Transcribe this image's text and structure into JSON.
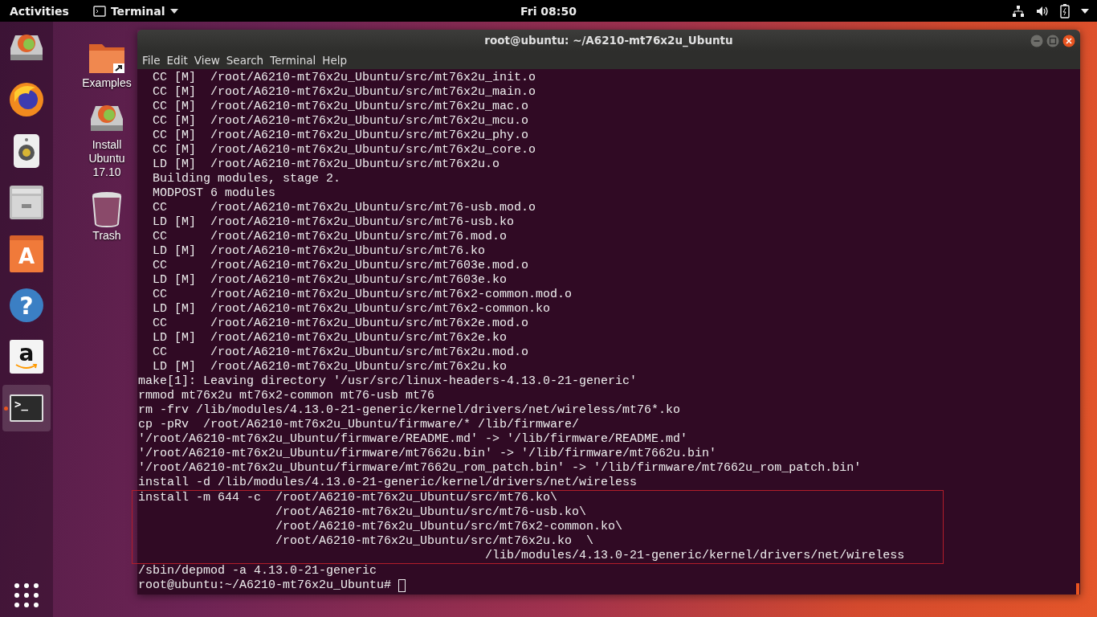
{
  "top_bar": {
    "activities": "Activities",
    "app_menu": "Terminal",
    "clock": "Fri 08:50"
  },
  "dock": [
    {
      "kind": "installer",
      "running": false
    },
    {
      "kind": "browser",
      "running": false
    },
    {
      "kind": "speaker",
      "running": false
    },
    {
      "kind": "files",
      "running": false
    },
    {
      "kind": "software",
      "running": false,
      "glyph": "A"
    },
    {
      "kind": "help",
      "running": false,
      "glyph": "?"
    },
    {
      "kind": "amazon",
      "running": false,
      "glyph": "a"
    },
    {
      "kind": "terminal",
      "running": true,
      "glyph": ">_"
    }
  ],
  "desktop_icons": [
    {
      "kind": "folder",
      "label": "Examples"
    },
    {
      "kind": "installer",
      "label": "Install\nUbuntu\n17.10"
    },
    {
      "kind": "trash",
      "label": "Trash"
    }
  ],
  "window": {
    "title": "root@ubuntu: ~/A6210-mt76x2u_Ubuntu",
    "menu": [
      "File",
      "Edit",
      "View",
      "Search",
      "Terminal",
      "Help"
    ]
  },
  "terminal": {
    "lines_before": [
      "  CC [M]  /root/A6210-mt76x2u_Ubuntu/src/mt76x2u_init.o",
      "  CC [M]  /root/A6210-mt76x2u_Ubuntu/src/mt76x2u_main.o",
      "  CC [M]  /root/A6210-mt76x2u_Ubuntu/src/mt76x2u_mac.o",
      "  CC [M]  /root/A6210-mt76x2u_Ubuntu/src/mt76x2u_mcu.o",
      "  CC [M]  /root/A6210-mt76x2u_Ubuntu/src/mt76x2u_phy.o",
      "  CC [M]  /root/A6210-mt76x2u_Ubuntu/src/mt76x2u_core.o",
      "  LD [M]  /root/A6210-mt76x2u_Ubuntu/src/mt76x2u.o",
      "  Building modules, stage 2.",
      "  MODPOST 6 modules",
      "  CC      /root/A6210-mt76x2u_Ubuntu/src/mt76-usb.mod.o",
      "  LD [M]  /root/A6210-mt76x2u_Ubuntu/src/mt76-usb.ko",
      "  CC      /root/A6210-mt76x2u_Ubuntu/src/mt76.mod.o",
      "  LD [M]  /root/A6210-mt76x2u_Ubuntu/src/mt76.ko",
      "  CC      /root/A6210-mt76x2u_Ubuntu/src/mt7603e.mod.o",
      "  LD [M]  /root/A6210-mt76x2u_Ubuntu/src/mt7603e.ko",
      "  CC      /root/A6210-mt76x2u_Ubuntu/src/mt76x2-common.mod.o",
      "  LD [M]  /root/A6210-mt76x2u_Ubuntu/src/mt76x2-common.ko",
      "  CC      /root/A6210-mt76x2u_Ubuntu/src/mt76x2e.mod.o",
      "  LD [M]  /root/A6210-mt76x2u_Ubuntu/src/mt76x2e.ko",
      "  CC      /root/A6210-mt76x2u_Ubuntu/src/mt76x2u.mod.o",
      "  LD [M]  /root/A6210-mt76x2u_Ubuntu/src/mt76x2u.ko",
      "make[1]: Leaving directory '/usr/src/linux-headers-4.13.0-21-generic'",
      "rmmod mt76x2u mt76x2-common mt76-usb mt76",
      "rm -frv /lib/modules/4.13.0-21-generic/kernel/drivers/net/wireless/mt76*.ko",
      "cp -pRv  /root/A6210-mt76x2u_Ubuntu/firmware/* /lib/firmware/",
      "'/root/A6210-mt76x2u_Ubuntu/firmware/README.md' -> '/lib/firmware/README.md'",
      "'/root/A6210-mt76x2u_Ubuntu/firmware/mt7662u.bin' -> '/lib/firmware/mt7662u.bin'",
      "'/root/A6210-mt76x2u_Ubuntu/firmware/mt7662u_rom_patch.bin' -> '/lib/firmware/mt7662u_rom_patch.bin'",
      "install -d /lib/modules/4.13.0-21-generic/kernel/drivers/net/wireless"
    ],
    "highlighted_lines": [
      "install -m 644 -c  /root/A6210-mt76x2u_Ubuntu/src/mt76.ko\\",
      "                   /root/A6210-mt76x2u_Ubuntu/src/mt76-usb.ko\\",
      "                   /root/A6210-mt76x2u_Ubuntu/src/mt76x2-common.ko\\",
      "                   /root/A6210-mt76x2u_Ubuntu/src/mt76x2u.ko  \\",
      "                                                /lib/modules/4.13.0-21-generic/kernel/drivers/net/wireless"
    ],
    "lines_after": [
      "/sbin/depmod -a 4.13.0-21-generic"
    ],
    "prompt": "root@ubuntu:~/A6210-mt76x2u_Ubuntu#"
  }
}
